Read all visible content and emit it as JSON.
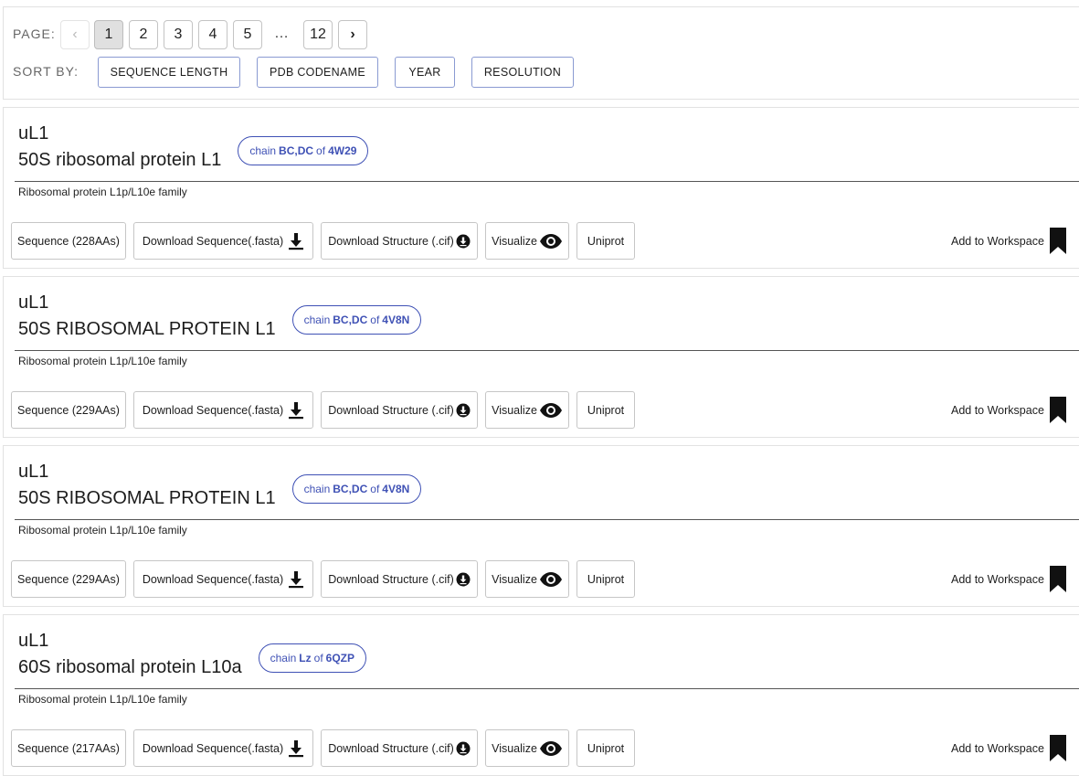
{
  "pagination": {
    "label": "PAGE:",
    "prev": "‹",
    "next": "›",
    "pages": [
      "1",
      "2",
      "3",
      "4",
      "5"
    ],
    "ellipsis": "…",
    "last": "12",
    "current": "1"
  },
  "sort": {
    "label": "SORT BY:",
    "options": [
      "SEQUENCE LENGTH",
      "PDB CODENAME",
      "YEAR",
      "RESOLUTION"
    ]
  },
  "actions": {
    "download_fasta": "Download Sequence(.fasta)",
    "download_cif": "Download Structure (.cif)",
    "visualize": "Visualize",
    "uniprot": "Uniprot",
    "workspace": "Add to Workspace"
  },
  "chip_text": {
    "chain": "chain",
    "of": "of"
  },
  "cards": [
    {
      "class": "uL1",
      "name": "50S ribosomal protein L1",
      "chain": "BC,DC",
      "pdb": "4W29",
      "family": "Ribosomal protein L1p/L10e family",
      "sequence": "Sequence (228AAs)"
    },
    {
      "class": "uL1",
      "name": "50S RIBOSOMAL PROTEIN L1",
      "chain": "BC,DC",
      "pdb": "4V8N",
      "family": "Ribosomal protein L1p/L10e family",
      "sequence": "Sequence (229AAs)"
    },
    {
      "class": "uL1",
      "name": "50S RIBOSOMAL PROTEIN L1",
      "chain": "BC,DC",
      "pdb": "4V8N",
      "family": "Ribosomal protein L1p/L10e family",
      "sequence": "Sequence (229AAs)"
    },
    {
      "class": "uL1",
      "name": "60S ribosomal protein L10a",
      "chain": "Lz",
      "pdb": "6QZP",
      "family": "Ribosomal protein L1p/L10e family",
      "sequence": "Sequence (217AAs)"
    }
  ],
  "colors": {
    "accent": "#3f51b5",
    "border": "#c6c6c6"
  }
}
